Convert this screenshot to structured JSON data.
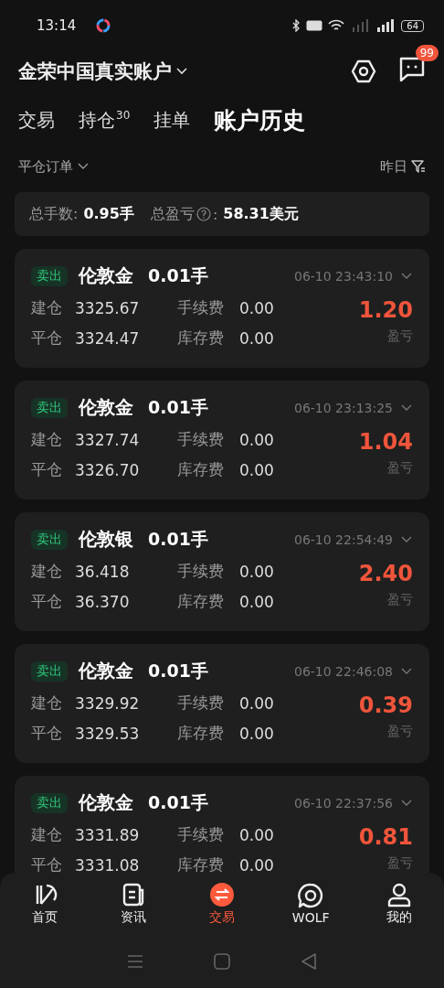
{
  "status_bar": {
    "time": "13:14",
    "battery": "64"
  },
  "header": {
    "account": "金荣中国真实账户",
    "message_badge": "99"
  },
  "tabs": [
    {
      "label": "交易",
      "selected": false
    },
    {
      "label": "持仓",
      "count": "30",
      "selected": false
    },
    {
      "label": "挂单",
      "selected": false
    },
    {
      "label": "账户历史",
      "selected": true
    }
  ],
  "filter": {
    "order_type": "平仓订单",
    "date": "昨日"
  },
  "summary": {
    "lots_label": "总手数:",
    "lots": "0.95手",
    "pnl_label": "总盈亏",
    "pnl_colon": ":",
    "pnl": "58.31美元"
  },
  "orders": [
    {
      "side": "卖出",
      "symbol": "伦敦金",
      "lots": "0.01手",
      "time": "06-10 23:43:10",
      "open_label": "建仓",
      "open": "3325.67",
      "close_label": "平仓",
      "close": "3324.47",
      "fee_label": "手续费",
      "fee": "0.00",
      "swap_label": "库存费",
      "swap": "0.00",
      "pnl": "1.20",
      "pnl_label": "盈亏"
    },
    {
      "side": "卖出",
      "symbol": "伦敦金",
      "lots": "0.01手",
      "time": "06-10 23:13:25",
      "open_label": "建仓",
      "open": "3327.74",
      "close_label": "平仓",
      "close": "3326.70",
      "fee_label": "手续费",
      "fee": "0.00",
      "swap_label": "库存费",
      "swap": "0.00",
      "pnl": "1.04",
      "pnl_label": "盈亏"
    },
    {
      "side": "卖出",
      "symbol": "伦敦银",
      "lots": "0.01手",
      "time": "06-10 22:54:49",
      "open_label": "建仓",
      "open": "36.418",
      "close_label": "平仓",
      "close": "36.370",
      "fee_label": "手续费",
      "fee": "0.00",
      "swap_label": "库存费",
      "swap": "0.00",
      "pnl": "2.40",
      "pnl_label": "盈亏"
    },
    {
      "side": "卖出",
      "symbol": "伦敦金",
      "lots": "0.01手",
      "time": "06-10 22:46:08",
      "open_label": "建仓",
      "open": "3329.92",
      "close_label": "平仓",
      "close": "3329.53",
      "fee_label": "手续费",
      "fee": "0.00",
      "swap_label": "库存费",
      "swap": "0.00",
      "pnl": "0.39",
      "pnl_label": "盈亏"
    },
    {
      "side": "卖出",
      "symbol": "伦敦金",
      "lots": "0.01手",
      "time": "06-10 22:37:56",
      "open_label": "建仓",
      "open": "3331.89",
      "close_label": "平仓",
      "close": "3331.08",
      "fee_label": "手续费",
      "fee": "0.00",
      "swap_label": "库存费",
      "swap": "0.00",
      "pnl": "0.81",
      "pnl_label": "盈亏"
    }
  ],
  "bottom_nav": [
    {
      "label": "首页",
      "kind": "home",
      "selected": false
    },
    {
      "label": "资讯",
      "kind": "news",
      "selected": false
    },
    {
      "label": "交易",
      "kind": "trade",
      "selected": true
    },
    {
      "label": "WOLF",
      "kind": "wolf",
      "selected": false
    },
    {
      "label": "我的",
      "kind": "profile",
      "selected": false
    }
  ]
}
